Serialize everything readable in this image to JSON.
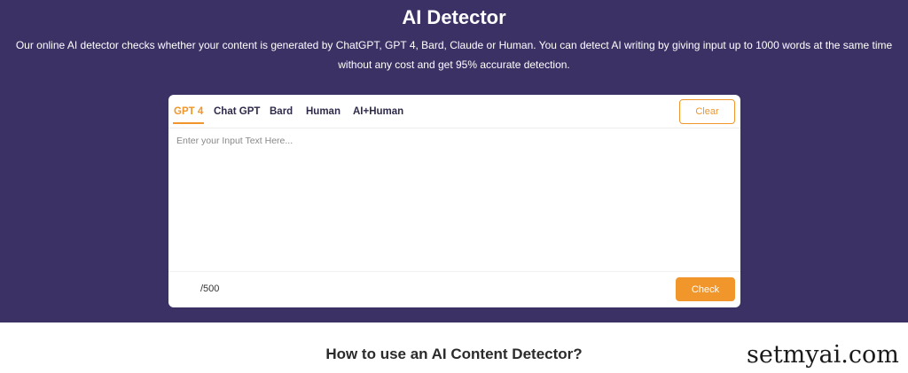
{
  "hero": {
    "title": "AI Detector",
    "subtitle_line1": "Our online AI detector checks whether your content is generated by ChatGPT, GPT 4, Bard, Claude or Human. You can detect AI writing by giving input up to 1000 words at the same time",
    "subtitle_line2": "without any cost and get 95% accurate detection."
  },
  "detector": {
    "tabs": [
      {
        "label": "GPT 4",
        "active": true
      },
      {
        "label": "Chat GPT",
        "active": false
      },
      {
        "label": "Bard",
        "active": false
      },
      {
        "label": "Human",
        "active": false
      },
      {
        "label": "AI+Human",
        "active": false
      }
    ],
    "clear_label": "Clear",
    "input_value": "",
    "input_placeholder": "Enter your Input Text Here...",
    "counter": "/500",
    "check_label": "Check"
  },
  "section": {
    "howto_title": "How to use an AI Content Detector?"
  },
  "watermark": {
    "text": "setmyai.com"
  },
  "colors": {
    "hero_bg": "#3b3164",
    "accent": "#f0962a",
    "card_bg": "#ffffff"
  }
}
